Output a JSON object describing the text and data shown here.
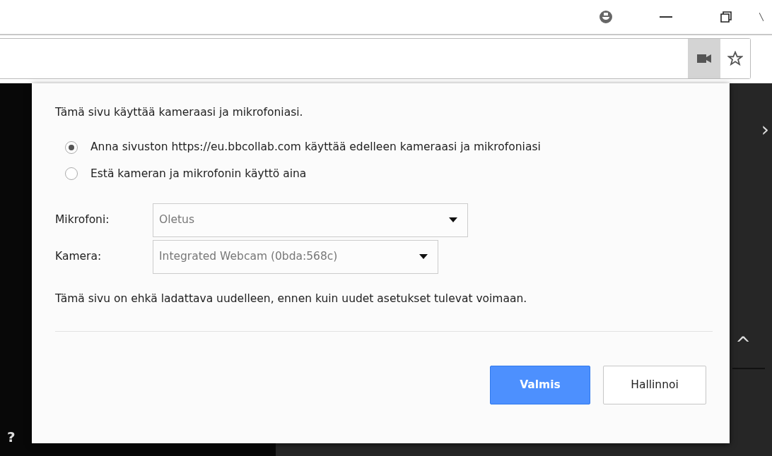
{
  "dialog": {
    "heading": "Tämä sivu käyttää kameraasi ja mikrofoniasi.",
    "options": [
      {
        "label": "Anna sivuston https://eu.bbcollab.com käyttää edelleen kameraasi ja mikrofoniasi",
        "selected": true
      },
      {
        "label": "Estä kameran ja mikrofonin käyttö aina",
        "selected": false
      }
    ],
    "devices": [
      {
        "label": "Mikrofoni:",
        "value": "Oletus"
      },
      {
        "label": "Kamera:",
        "value": "Integrated Webcam (0bda:568c)"
      }
    ],
    "note": "Tämä sivu on ehkä ladattava uudelleen, ennen kuin uudet asetukset tulevat voimaan.",
    "buttons": [
      {
        "label": "Valmis",
        "kind": "primary"
      },
      {
        "label": "Hallinnoi",
        "kind": "secondary"
      }
    ]
  },
  "page": {
    "left_text": "?",
    "right_chevron": "›",
    "right_caret": "^"
  }
}
